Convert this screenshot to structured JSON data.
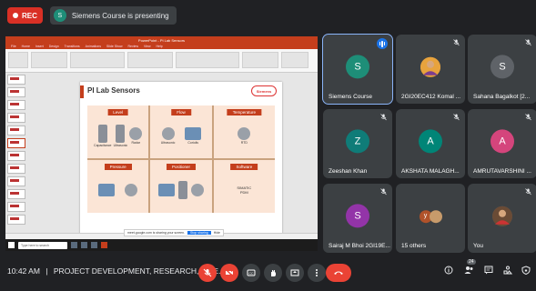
{
  "top": {
    "rec_label": "REC",
    "presenter_initial": "S",
    "presenting_text": "Siemens Course is presenting"
  },
  "shared_screen": {
    "app_title": "PowerPoint - Pi Lab Sensors",
    "ribbon_tabs": [
      "File",
      "Home",
      "Insert",
      "Design",
      "Transitions",
      "Animations",
      "Slide Show",
      "Review",
      "View",
      "Help"
    ],
    "slide": {
      "title": "PI Lab Sensors",
      "logo_text": "Siemens",
      "cells": [
        {
          "caption": "Level",
          "labels": [
            "Capacitance",
            "Ultrasonic",
            "Radar"
          ]
        },
        {
          "caption": "Flow",
          "labels": [
            "Ultrasonic",
            "Coriolis"
          ]
        },
        {
          "caption": "Temperature",
          "labels": [
            "RTD"
          ]
        },
        {
          "caption": "Pressure",
          "labels": []
        },
        {
          "caption": "Positioner",
          "labels": []
        },
        {
          "caption": "Software",
          "labels": [
            "SIMATIC",
            "PDM"
          ]
        }
      ]
    },
    "share_banner_text": "meet.google.com is sharing your screen.",
    "share_banner_stop": "Stop sharing",
    "share_banner_hide": "Hide",
    "taskbar_search": "Type here to search"
  },
  "participants": [
    {
      "name": "Siemens Course",
      "initial": "S",
      "color": "#1e8e78",
      "speaking": true
    },
    {
      "name": "2GI20EC412 Komal ...",
      "initial": "",
      "color": "#e8a33d",
      "photo": true
    },
    {
      "name": "Sahana Bagalkot [2...",
      "initial": "S",
      "color": "#5f6368"
    },
    {
      "name": "Zeeshan Khan",
      "initial": "Z",
      "color": "#0f7c78"
    },
    {
      "name": "AKSHATA MALAGH...",
      "initial": "A",
      "color": "#008577"
    },
    {
      "name": "AMRUTAVARSHINI ...",
      "initial": "A",
      "color": "#d4457c"
    },
    {
      "name": "Sairaj M Bhoi 2GI19E...",
      "initial": "S",
      "color": "#9334a8"
    },
    {
      "name": "15 others",
      "initial": "",
      "color": "#5f6368",
      "others": true
    },
    {
      "name": "You",
      "initial": "",
      "color": "#5f6368",
      "photo": true
    }
  ],
  "bottom": {
    "time": "10:42 AM",
    "separator": "|",
    "meeting_name": "PROJECT DEVELOPMENT, RESEARCH, INTE...",
    "people_count": "24"
  }
}
